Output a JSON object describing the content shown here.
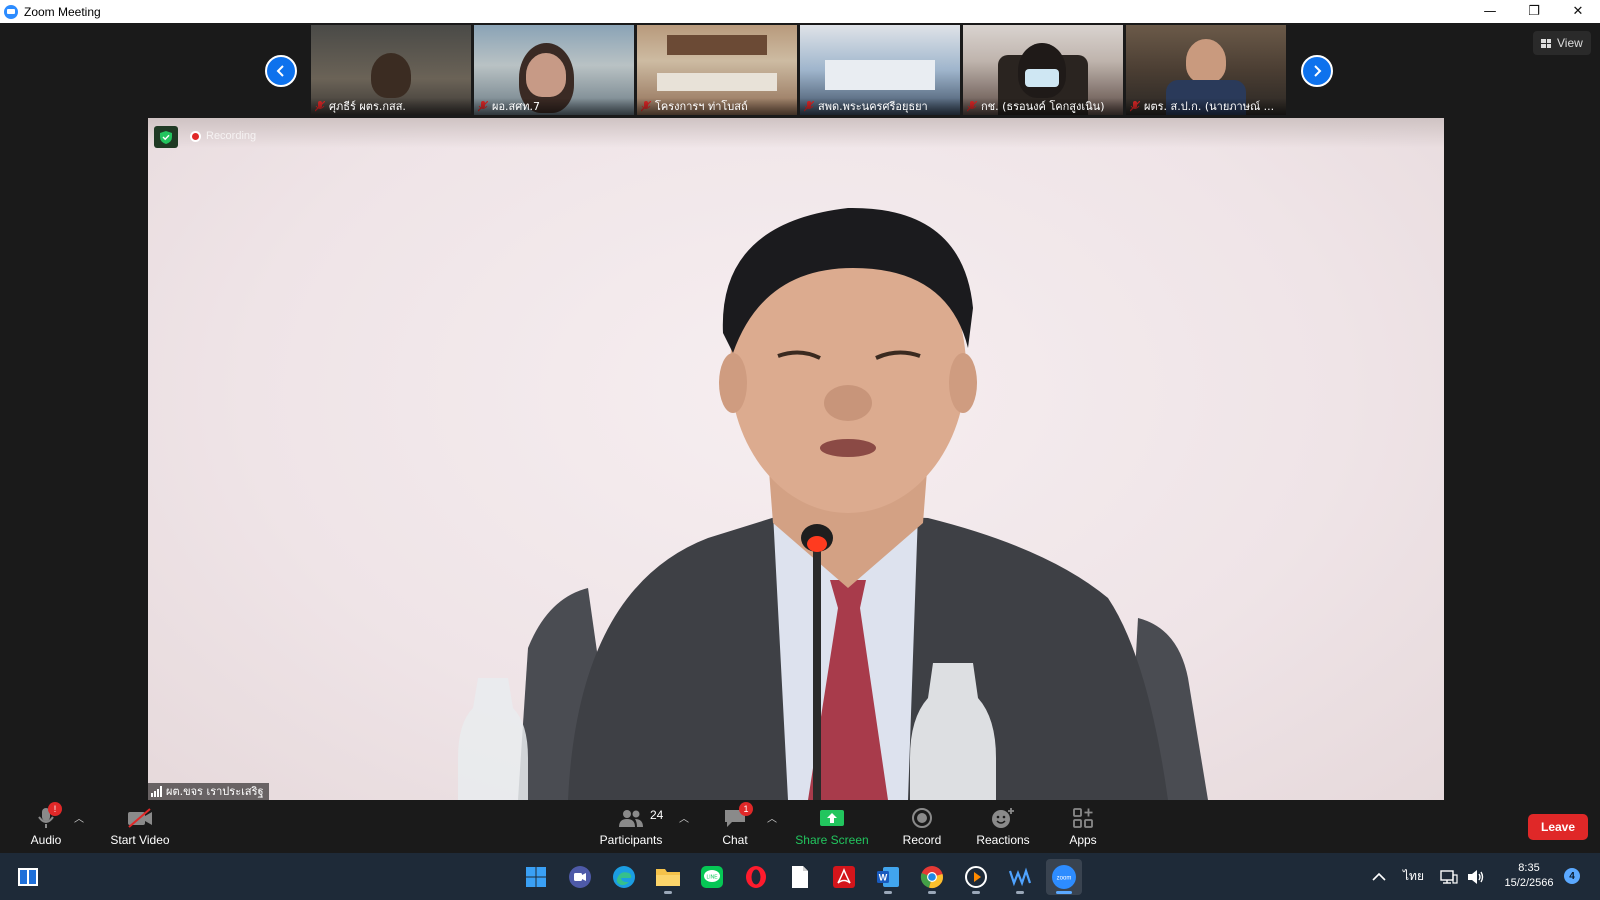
{
  "window": {
    "title": "Zoom Meeting",
    "minimize": "—",
    "restore": "❐",
    "close": "✕"
  },
  "gallery": {
    "participants": [
      {
        "name": "ศุภธีร์ ผตร.กสส."
      },
      {
        "name": "ผอ.สศท.7"
      },
      {
        "name": "โครงการฯ ท่าโบสถ์"
      },
      {
        "name": "สพด.พระนครศรีอยุธยา"
      },
      {
        "name": "กช. (ธรอนงค์ โคกสูงเนิน)"
      },
      {
        "name": "ผตร. ส.ป.ก. (นายภาษณ์ ..."
      }
    ],
    "view_label": "View"
  },
  "main": {
    "recording_label": "Recording",
    "speaker_name": "ผต.ขจร เราประเสริฐ"
  },
  "toolbar": {
    "audio": {
      "label": "Audio",
      "badge": "!"
    },
    "video": {
      "label": "Start Video"
    },
    "participants": {
      "label": "Participants",
      "count": "24"
    },
    "chat": {
      "label": "Chat",
      "badge": "1"
    },
    "share": {
      "label": "Share Screen"
    },
    "record": {
      "label": "Record"
    },
    "reactions": {
      "label": "Reactions"
    },
    "apps": {
      "label": "Apps"
    },
    "leave": {
      "label": "Leave"
    }
  },
  "taskbar": {
    "apps": [
      "start-icon",
      "zoom-meetings-icon",
      "edge-icon",
      "file-explorer-icon",
      "line-icon",
      "opera-icon",
      "notepad-icon",
      "acrobat-icon",
      "word-icon",
      "chrome-icon",
      "media-player-icon",
      "audio-app-icon",
      "zoom-icon"
    ],
    "language": "ไทย",
    "time": "8:35",
    "date": "15/2/2566",
    "notifications": "4"
  },
  "colors": {
    "accent": "#0e72ed",
    "leave": "#e02828",
    "share": "#22c55e",
    "taskbar": "#1e2a38"
  }
}
